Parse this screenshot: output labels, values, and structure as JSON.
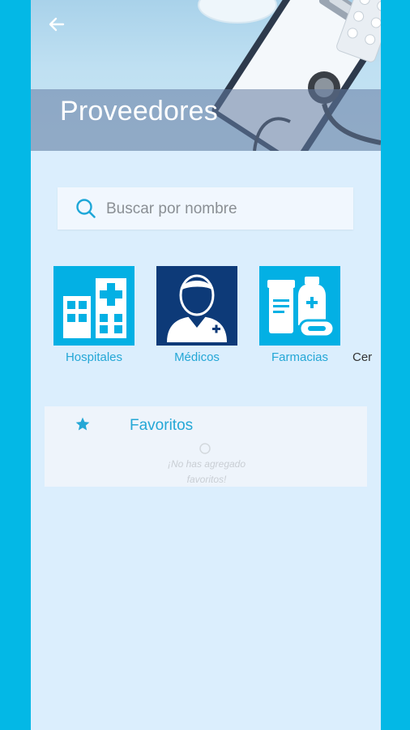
{
  "header": {
    "title": "Proveedores"
  },
  "search": {
    "placeholder": "Buscar por nombre"
  },
  "categories": [
    {
      "label": "Hospitales",
      "icon": "hospital-icon"
    },
    {
      "label": "Médicos",
      "icon": "doctor-icon"
    },
    {
      "label": "Farmacias",
      "icon": "pharmacy-icon"
    },
    {
      "label": "Cer",
      "icon": ""
    }
  ],
  "favorites": {
    "title": "Favoritos",
    "empty_message": "¡No has agregado favoritos!"
  },
  "colors": {
    "outer_background": "#03b8e6",
    "screen_background": "#dbeefd",
    "accent": "#24a7d6",
    "tile_cyan": "#03b0e4",
    "tile_navy": "#0d3a78"
  }
}
